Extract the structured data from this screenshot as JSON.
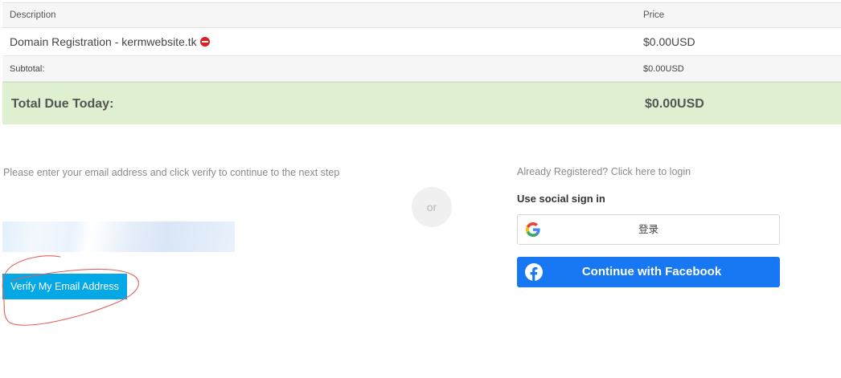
{
  "cart": {
    "headers": {
      "description": "Description",
      "price": "Price"
    },
    "item": {
      "description": "Domain Registration - kermwebsite.tk",
      "price": "$0.00USD"
    },
    "subtotal": {
      "label": "Subtotal:",
      "value": "$0.00USD"
    },
    "total": {
      "label": "Total Due Today:",
      "value": "$0.00USD"
    }
  },
  "verify": {
    "intro_text": "Please enter your email address and click verify to continue to the next step",
    "email_value": "",
    "button_label": "Verify My Email Address"
  },
  "divider": {
    "or_label": "or"
  },
  "login": {
    "already_registered_link": "Already Registered? Click here to login",
    "social_label": "Use social sign in",
    "google_button_label": "登录",
    "facebook_button_label": "Continue with Facebook"
  },
  "colors": {
    "accent": "#03a9e6",
    "total_bg": "#dff0d0",
    "facebook": "#1877f2",
    "remove": "#e01e1e",
    "annotation": "#e06060"
  }
}
